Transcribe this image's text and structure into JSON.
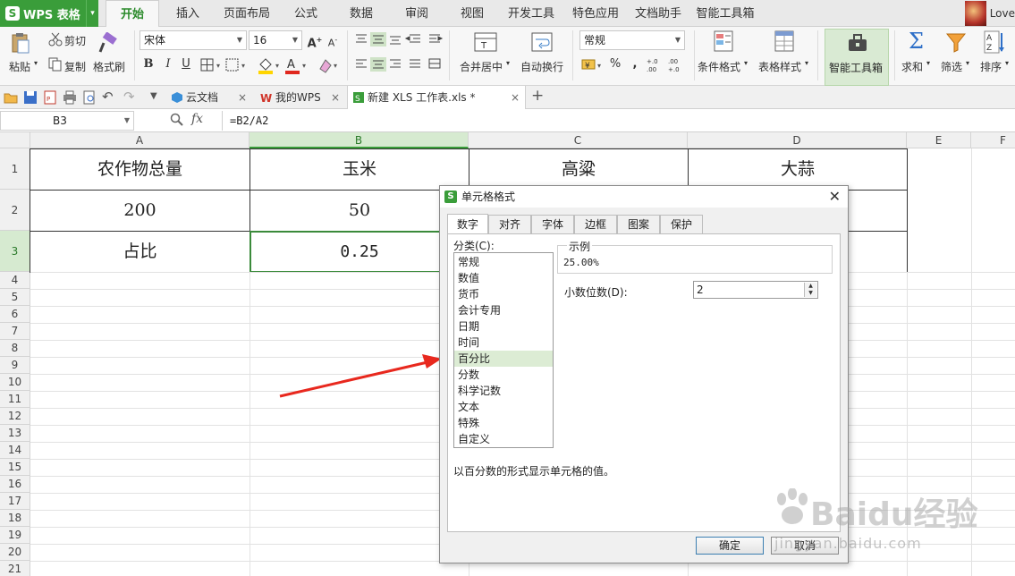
{
  "app": {
    "name": "WPS 表格",
    "user": "Love"
  },
  "menu_tabs": [
    "开始",
    "插入",
    "页面布局",
    "公式",
    "数据",
    "审阅",
    "视图",
    "开发工具",
    "特色应用",
    "文档助手",
    "智能工具箱"
  ],
  "ribbon": {
    "paste": "粘贴",
    "cut": "剪切",
    "copy": "复制",
    "format_painter": "格式刷",
    "font_name": "宋体",
    "font_size": "16",
    "bold": "B",
    "italic": "I",
    "underline": "U",
    "merge_center": "合并居中",
    "wrap_text": "自动换行",
    "number_format": "常规",
    "percent": "%",
    "comma": "⁹",
    "inc_decimal": "+.0\n.00",
    "dec_decimal": ".00\n+.0",
    "cond_format": "条件格式",
    "table_style": "表格样式",
    "smart_toolbox": "智能工具箱",
    "sum": "求和",
    "filter": "筛选",
    "sort": "排序"
  },
  "doc_tabs": [
    {
      "label": "云文档",
      "active": false
    },
    {
      "label": "我的WPS",
      "active": false
    },
    {
      "label": "新建 XLS 工作表.xls *",
      "active": true
    }
  ],
  "new_tab": "+",
  "formula_bar": {
    "name_box": "B3",
    "fx": "fx",
    "formula": "=B2/A2"
  },
  "columns": [
    "A",
    "B",
    "C",
    "D",
    "E",
    "F"
  ],
  "rows": [
    "1",
    "2",
    "3",
    "4",
    "5",
    "6",
    "7",
    "8",
    "9",
    "10",
    "11",
    "12",
    "13",
    "14",
    "15",
    "16",
    "17",
    "18",
    "19",
    "20",
    "21"
  ],
  "cells": {
    "A1": "农作物总量",
    "B1": "玉米",
    "C1": "高粱",
    "D1": "大蒜",
    "A2": "200",
    "B2": "50",
    "A3": "占比",
    "B3": "0.25"
  },
  "dialog": {
    "title": "单元格格式",
    "tabs": [
      "数字",
      "对齐",
      "字体",
      "边框",
      "图案",
      "保护"
    ],
    "category_label": "分类(C):",
    "categories": [
      "常规",
      "数值",
      "货币",
      "会计专用",
      "日期",
      "时间",
      "百分比",
      "分数",
      "科学记数",
      "文本",
      "特殊",
      "自定义"
    ],
    "selected_category": "百分比",
    "sample_label": "示例",
    "sample_value": "25.00%",
    "decimals_label": "小数位数(D):",
    "decimals_value": "2",
    "description": "以百分数的形式显示单元格的值。",
    "ok": "确定",
    "cancel": "取消"
  },
  "watermark": {
    "brand": "Baidu经验",
    "url": "jingyan.baidu.com"
  },
  "colors": {
    "accent": "#3a9d3a",
    "selection": "#d6ead0",
    "arrow": "#e8281e"
  }
}
